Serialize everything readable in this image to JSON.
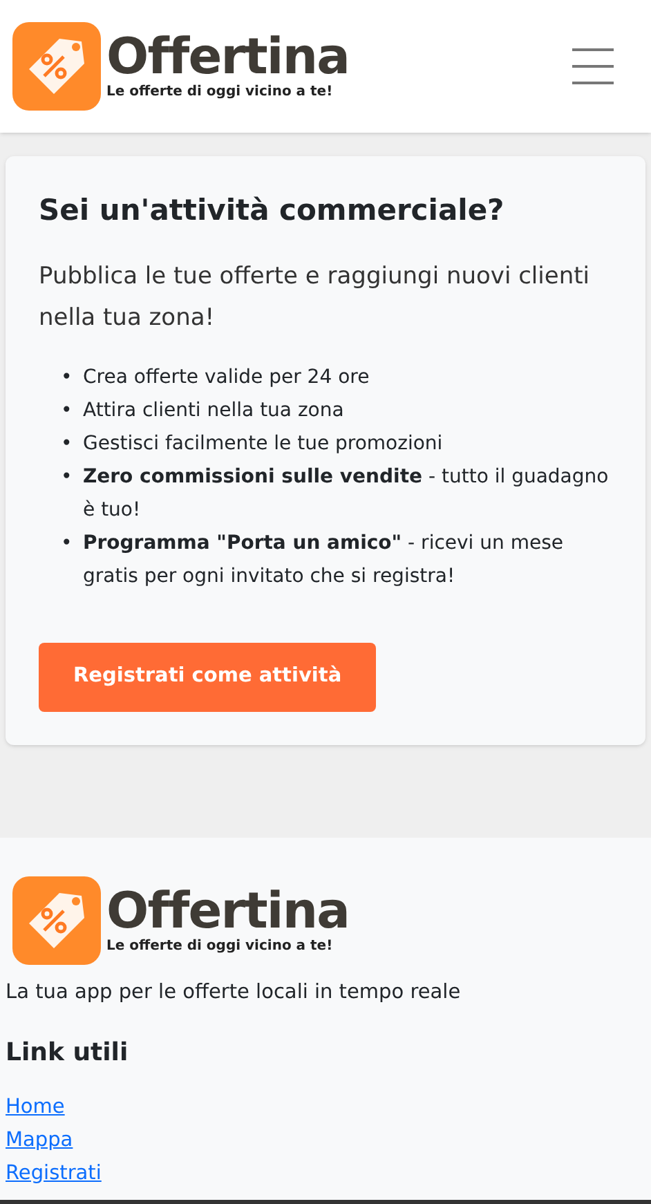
{
  "header": {
    "logo": {
      "name": "Offertina",
      "tagline": "Le offerte di oggi vicino a te!"
    }
  },
  "promo": {
    "title": "Sei un'attività commerciale?",
    "lead": "Pubblica le tue offerte e raggiungi nuovi clienti nella tua zona!",
    "bullet_marker": "•",
    "bullets": [
      "Crea offerte valide per 24 ore",
      "Attira clienti nella tua zona",
      "Gestisci facilmente le tue promozioni",
      "**Zero commissioni sulle vendite** - tutto il guadagno è tuo!",
      "**Programma \"Porta un amico\"** - ricevi un mese gratis per ogni invitato che si registra!"
    ],
    "button": "Registrati come attività"
  },
  "footer": {
    "logo": {
      "name": "Offertina",
      "tagline": "Le offerte di oggi vicino a te!"
    },
    "description": "La tua app per le offerte locali in tempo reale",
    "links_title": "Link utili",
    "links": [
      "Home",
      "Mappa",
      "Registrati"
    ]
  }
}
